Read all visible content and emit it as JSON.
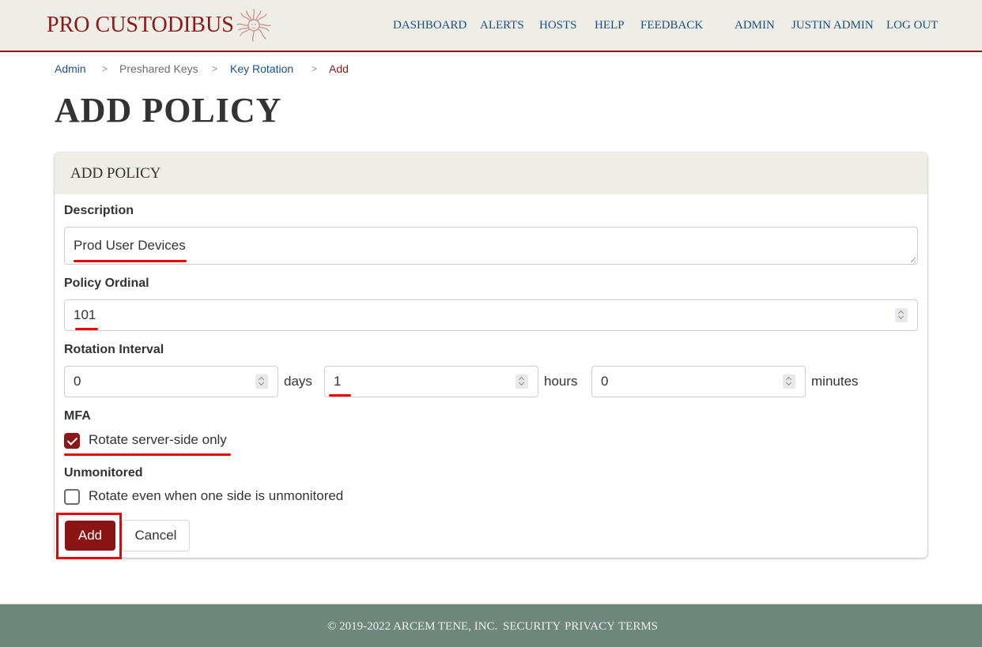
{
  "header": {
    "brand": "PRO CUSTODIBUS",
    "logo_icon": "medusa-logo-icon",
    "nav": [
      {
        "label": "DASHBOARD"
      },
      {
        "label": "ALERTS"
      },
      {
        "label": "HOSTS"
      },
      {
        "label": "HELP"
      },
      {
        "label": "FEEDBACK"
      }
    ],
    "user_nav": [
      {
        "label": "ADMIN"
      },
      {
        "label": "JUSTIN ADMIN"
      },
      {
        "label": "LOG OUT"
      }
    ]
  },
  "breadcrumb": {
    "items": [
      "Admin",
      "Preshared Keys",
      "Key Rotation",
      "Add"
    ],
    "separator": ">"
  },
  "page_title": "ADD POLICY",
  "form": {
    "title": "ADD POLICY",
    "description": {
      "label": "Description",
      "value": "Prod User Devices"
    },
    "ordinal": {
      "label": "Policy Ordinal",
      "value": "101"
    },
    "rotation_interval": {
      "label": "Rotation Interval",
      "days": {
        "value": "0",
        "unit": "days"
      },
      "hours": {
        "value": "1",
        "unit": "hours"
      },
      "minutes": {
        "value": "0",
        "unit": "minutes"
      }
    },
    "mfa": {
      "label": "MFA",
      "option": "Rotate server-side only",
      "checked": true
    },
    "unmonitored": {
      "label": "Unmonitored",
      "option": "Rotate even when one side is unmonitored",
      "checked": false
    },
    "submit_label": "Add",
    "cancel_label": "Cancel"
  },
  "footer": {
    "copyright": "© 2019-2022 ARCEM TENE, INC.",
    "links": [
      "SECURITY",
      "PRIVACY",
      "TERMS"
    ]
  },
  "colors": {
    "brand": "#8a1a1a",
    "link": "#1d5080",
    "header_bg": "#eeede6",
    "footer_bg": "#6e877d",
    "annotation": "#ee0000"
  }
}
